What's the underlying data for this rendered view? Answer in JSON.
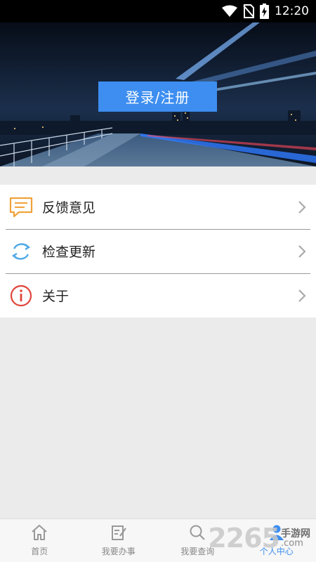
{
  "status_bar": {
    "time": "12:20",
    "icons": [
      "wifi-icon",
      "no-sim-icon",
      "battery-charging-icon"
    ]
  },
  "banner": {
    "login_label": "登录/注册"
  },
  "menu": {
    "items": [
      {
        "label": "反馈意见",
        "icon": "feedback-icon"
      },
      {
        "label": "检查更新",
        "icon": "refresh-icon"
      },
      {
        "label": "关于",
        "icon": "info-icon"
      }
    ]
  },
  "tabbar": {
    "tabs": [
      {
        "label": "首页",
        "icon": "home-icon",
        "active": false
      },
      {
        "label": "我要办事",
        "icon": "edit-icon",
        "active": false
      },
      {
        "label": "我要查询",
        "icon": "search-icon",
        "active": false
      },
      {
        "label": "个人中心",
        "icon": "user-icon",
        "active": true
      }
    ]
  },
  "watermark": {
    "number": "2265",
    "cn_text": "手游网",
    "domain": ".com"
  },
  "colors": {
    "accent": "#3d8ef0",
    "feedback_icon": "#f0a23a",
    "refresh_icon": "#4da8e6",
    "info_icon": "#e0453a"
  }
}
